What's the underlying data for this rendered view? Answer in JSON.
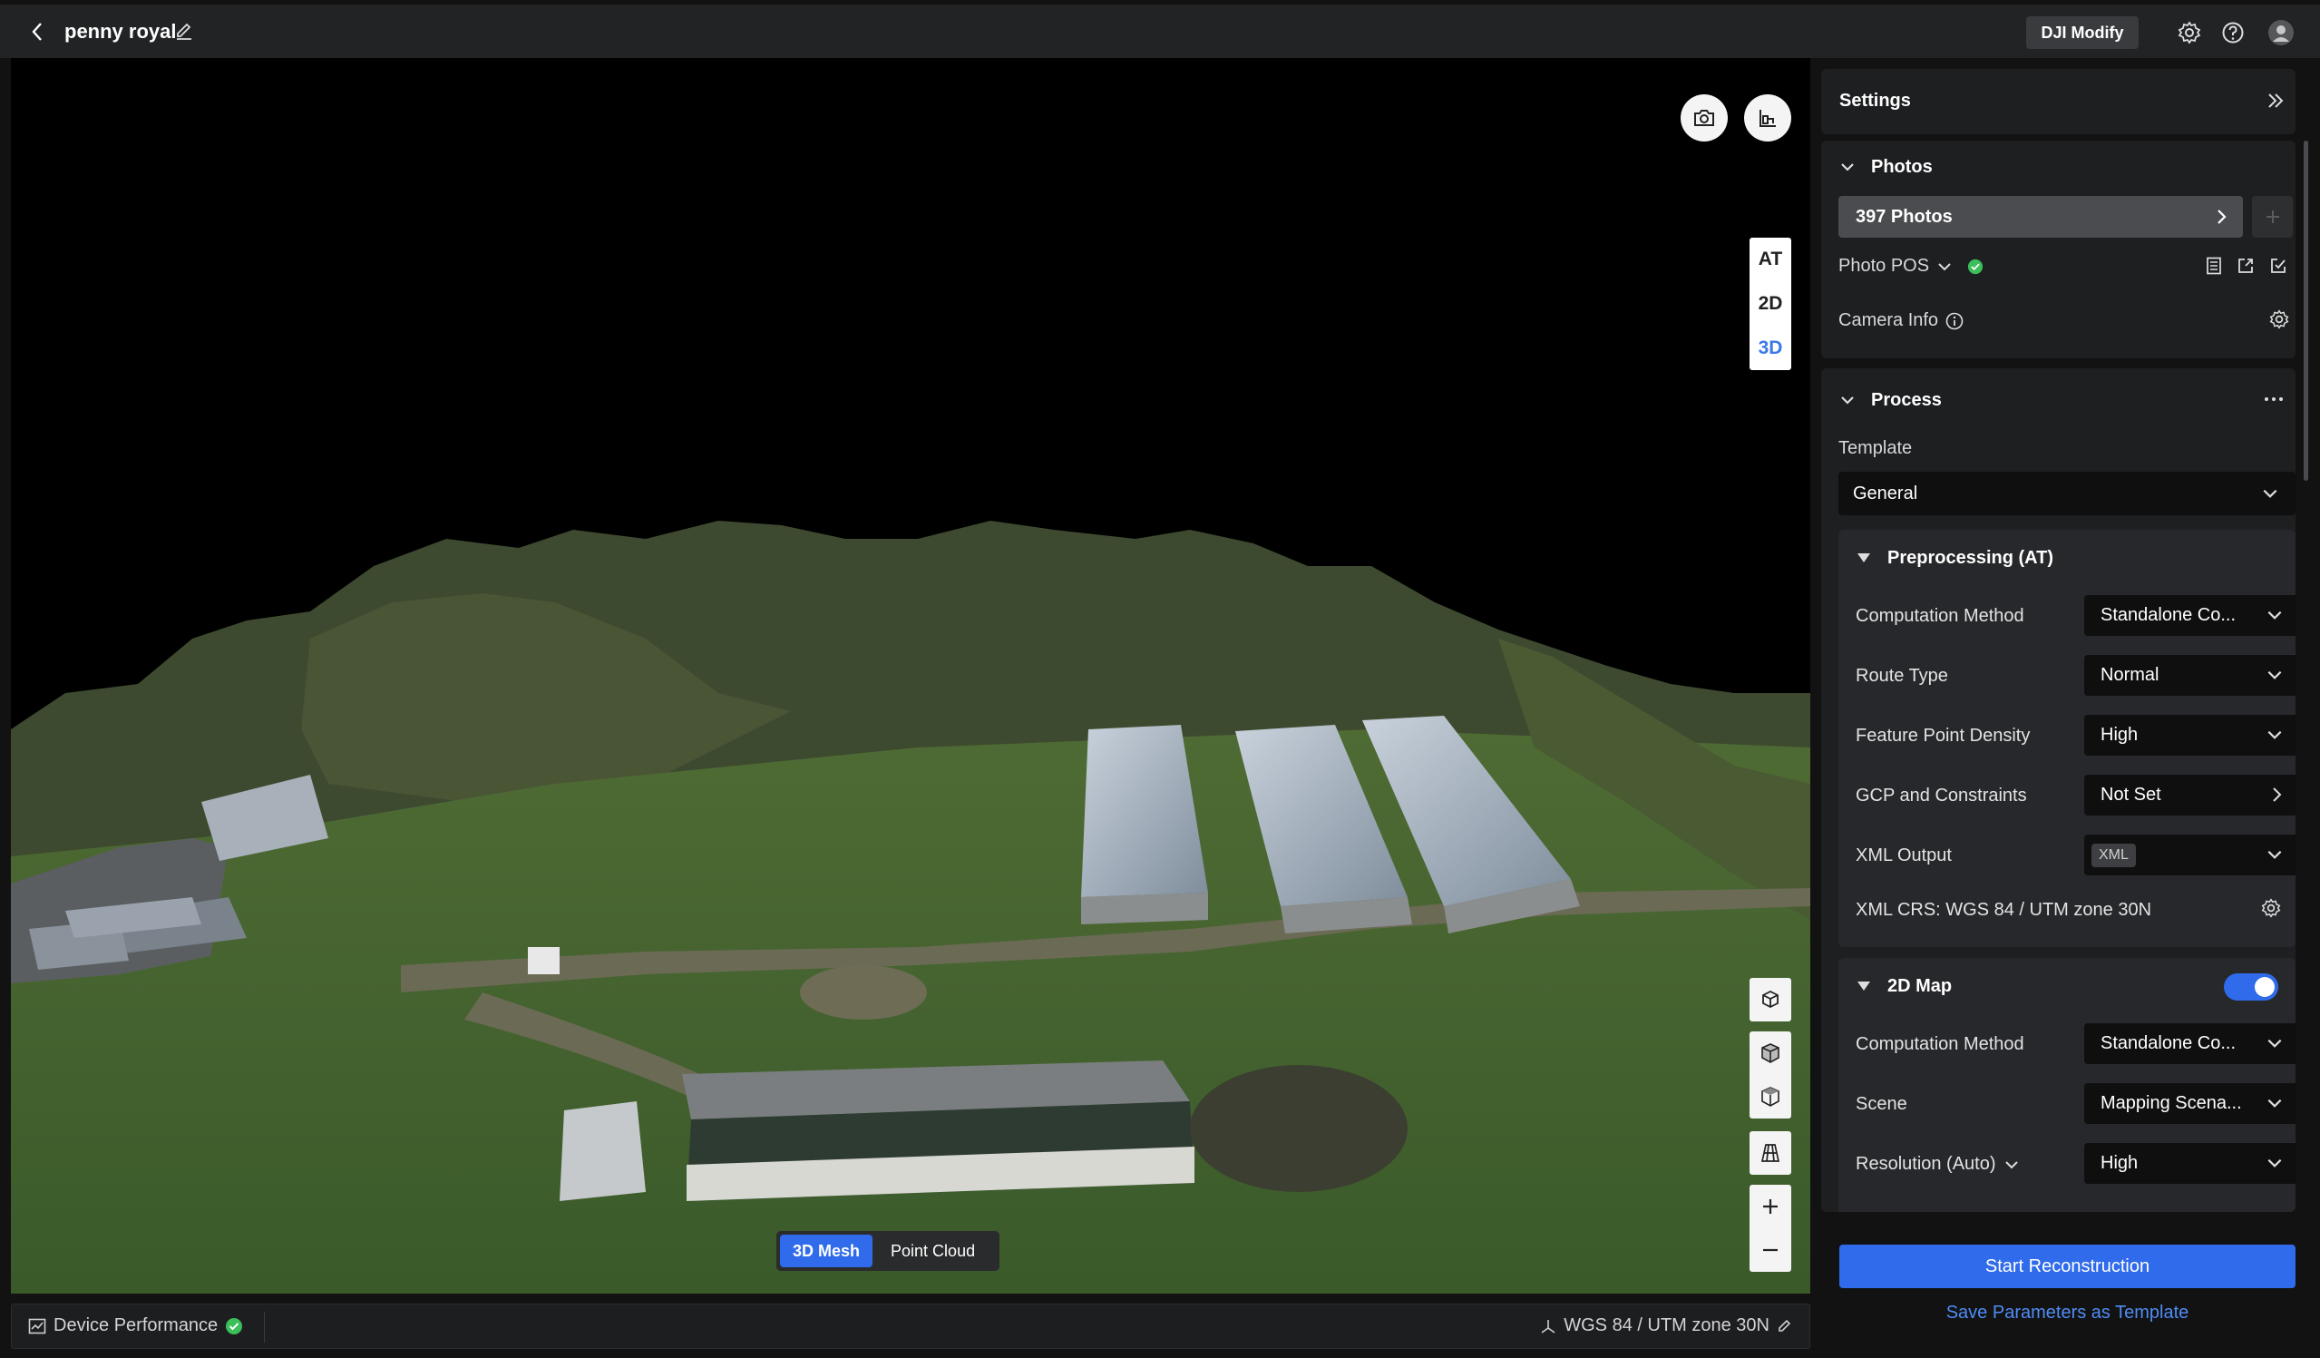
{
  "header": {
    "project_title": "penny royal",
    "modify_button": "DJI Modify"
  },
  "viewport": {
    "view_modes": [
      "AT",
      "2D",
      "3D"
    ],
    "active_view_mode": "3D",
    "render_modes": [
      "3D Mesh",
      "Point Cloud"
    ],
    "active_render_mode": "3D Mesh"
  },
  "statusbar": {
    "device_performance": "Device Performance",
    "crs": "WGS 84 / UTM zone 30N"
  },
  "settings": {
    "title": "Settings",
    "photos": {
      "section_title": "Photos",
      "count_label": "397 Photos",
      "photo_pos_label": "Photo POS",
      "camera_info_label": "Camera Info"
    },
    "process": {
      "section_title": "Process",
      "template_label": "Template",
      "template_value": "General",
      "preprocessing": {
        "title": "Preprocessing (AT)",
        "computation_method_label": "Computation Method",
        "computation_method_value": "Standalone Co...",
        "route_type_label": "Route Type",
        "route_type_value": "Normal",
        "feature_density_label": "Feature Point Density",
        "feature_density_value": "High",
        "gcp_label": "GCP and Constraints",
        "gcp_value": "Not Set",
        "xml_output_label": "XML Output",
        "xml_output_tag": "XML",
        "xml_crs_label": "XML CRS: WGS 84 / UTM zone 30N"
      },
      "map2d": {
        "title": "2D Map",
        "enabled": true,
        "computation_method_label": "Computation Method",
        "computation_method_value": "Standalone Co...",
        "scene_label": "Scene",
        "scene_value": "Mapping Scena...",
        "resolution_label": "Resolution (Auto)",
        "resolution_value": "High"
      }
    },
    "start_button": "Start Reconstruction",
    "save_template_link": "Save Parameters as Template"
  },
  "colors": {
    "accent": "#2f6bea",
    "status_ok": "#3bbf5a"
  }
}
